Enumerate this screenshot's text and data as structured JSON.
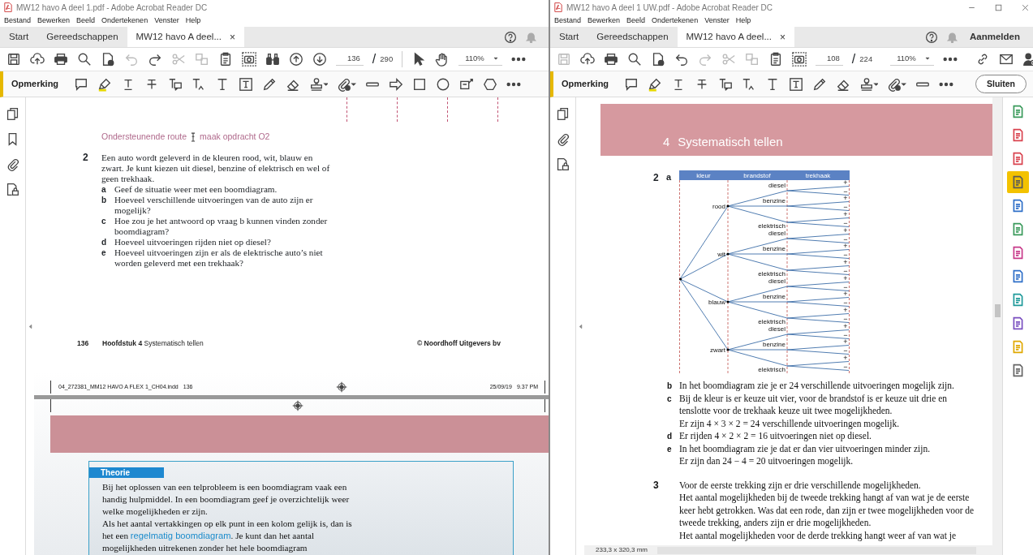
{
  "windows": [
    {
      "title": "MW12 havo A deel 1.pdf - Adobe Acrobat Reader DC",
      "menu": [
        "Bestand",
        "Bewerken",
        "Beeld",
        "Ondertekenen",
        "Venster",
        "Help"
      ],
      "tabs": [
        {
          "label": "Start",
          "selected": false
        },
        {
          "label": "Gereedschappen",
          "selected": false
        },
        {
          "label": "MW12 havo A deel...",
          "selected": true,
          "close": "×"
        }
      ],
      "toolbar": [
        {
          "kind": "save",
          "disabled": false
        },
        {
          "kind": "upload",
          "disabled": false
        },
        {
          "kind": "print",
          "disabled": false
        },
        {
          "kind": "search",
          "disabled": false
        },
        {
          "kind": "filecheck",
          "disabled": false
        },
        {
          "kind": "undo",
          "disabled": true
        },
        {
          "kind": "redo",
          "disabled": false
        },
        {
          "kind": "cut",
          "disabled": true
        },
        {
          "kind": "copy",
          "disabled": true
        },
        {
          "kind": "clipboard",
          "disabled": false
        },
        {
          "kind": "snapshot",
          "disabled": false
        },
        {
          "kind": "binoculars",
          "disabled": false
        },
        {
          "kind": "pageup",
          "disabled": false
        },
        {
          "kind": "pagedown",
          "disabled": false
        },
        {
          "kind": "page",
          "current": "136",
          "separator": "/",
          "total": "290"
        },
        {
          "kind": "divider"
        },
        {
          "kind": "pointer",
          "disabled": false
        },
        {
          "kind": "hand",
          "disabled": false
        },
        {
          "kind": "zoom",
          "value": "110%"
        },
        {
          "kind": "more",
          "disabled": false
        }
      ],
      "comment_label": "Opmerking",
      "comment_tools": [
        {
          "kind": "comment"
        },
        {
          "kind": "highlight"
        },
        {
          "kind": "underline"
        },
        {
          "kind": "strike"
        },
        {
          "kind": "replace"
        },
        {
          "kind": "insert"
        },
        {
          "kind": "text"
        },
        {
          "kind": "textbox"
        },
        {
          "kind": "pencil"
        },
        {
          "kind": "eraser"
        },
        {
          "kind": "stamp"
        },
        {
          "kind": "attach"
        },
        {
          "kind": "line"
        },
        {
          "kind": "arrow"
        },
        {
          "kind": "rect"
        },
        {
          "kind": "oval"
        },
        {
          "kind": "callout"
        },
        {
          "kind": "polygon"
        },
        {
          "kind": "more"
        }
      ],
      "side_panel": [
        {
          "kind": "pages"
        },
        {
          "kind": "bookmark"
        },
        {
          "kind": "clip"
        },
        {
          "kind": "lockdoc"
        }
      ],
      "document": [
        {
          "kind": "crop-marks"
        },
        {
          "kind": "route",
          "parts": [
            "Ondersteunende route",
            "maak opdracht O2"
          ]
        },
        {
          "kind": "exercise",
          "number": "2",
          "paragraphs": [
            "Een auto wordt geleverd in de kleuren rood, wit, blauw en zwart. Je kunt kiezen uit diesel, benzine of elektrisch en wel of geen trekhaak."
          ],
          "items": [
            {
              "letter": "a",
              "paragraphs": [
                "Geef de situatie weer met een boomdiagram."
              ]
            },
            {
              "letter": "b",
              "paragraphs": [
                "Hoeveel verschillende uitvoeringen van de auto zijn er mogelijk?"
              ]
            },
            {
              "letter": "c",
              "paragraphs": [
                "Hoe zou je het antwoord op vraag b kunnen vinden zonder boomdiagram?"
              ]
            },
            {
              "letter": "d",
              "paragraphs": [
                "Hoeveel uitvoeringen rijden niet op diesel?"
              ]
            },
            {
              "letter": "e",
              "paragraphs": [
                "Hoeveel uitvoeringen zijn er als de elektrische auto’s niet worden geleverd met een trekhaak?"
              ]
            }
          ]
        },
        {
          "kind": "footer",
          "page": "136",
          "chapter": "**Hoofdstuk 4** Systematisch tellen",
          "copyright": "© Noordhoff Uitgevers bv"
        },
        {
          "kind": "slug",
          "file": "04_272381_MM12 HAVO A FLEX 1_CH04.indd",
          "page": "136",
          "date": "25/09/19",
          "time": "9.37 PM"
        },
        {
          "kind": "page-break"
        },
        {
          "kind": "band"
        },
        {
          "kind": "theory",
          "title": "Theorie",
          "paragraphs": [
            "Bij het oplossen van een telprobleem is een boomdiagram vaak een handig hulpmiddel. In een boomdiagram geef je overzichtelijk weer welke mogelijkheden er zijn.",
            "Als het aantal vertakkingen op elk punt in een kolom gelijk is, dan is het een **regelmatig boomdiagram**. Je kunt dan het aantal mogelijkheden uitrekenen zonder het hele boomdiagram"
          ]
        }
      ]
    },
    {
      "title": "MW12 havo A deel 1 UW.pdf - Adobe Acrobat Reader DC",
      "window_controls": true,
      "menu": [
        "Bestand",
        "Bewerken",
        "Beeld",
        "Ondertekenen",
        "Venster",
        "Help"
      ],
      "tabs": [
        {
          "label": "Start",
          "selected": false
        },
        {
          "label": "Gereedschappen",
          "selected": false
        },
        {
          "label": "MW12 havo A deel...",
          "selected": true,
          "close": "×"
        }
      ],
      "sign_in": "Aanmelden",
      "toolbar": [
        {
          "kind": "save",
          "disabled": true
        },
        {
          "kind": "upload",
          "disabled": false
        },
        {
          "kind": "print",
          "disabled": false
        },
        {
          "kind": "search",
          "disabled": false
        },
        {
          "kind": "filecheck",
          "disabled": false
        },
        {
          "kind": "undo",
          "disabled": false
        },
        {
          "kind": "redo",
          "disabled": true
        },
        {
          "kind": "cut",
          "disabled": true
        },
        {
          "kind": "copy",
          "disabled": true
        },
        {
          "kind": "clipboard",
          "disabled": false
        },
        {
          "kind": "snapshot",
          "disabled": false
        },
        {
          "kind": "page",
          "current": "108",
          "separator": "/",
          "total": "224"
        },
        {
          "kind": "divider"
        },
        {
          "kind": "zoom",
          "value": "110%"
        },
        {
          "kind": "more",
          "disabled": false
        },
        {
          "kind": "spacer"
        },
        {
          "kind": "link",
          "disabled": false
        },
        {
          "kind": "mail",
          "disabled": false
        },
        {
          "kind": "person",
          "disabled": false
        }
      ],
      "comment_label": "Opmerking",
      "comment_tools": [
        {
          "kind": "comment"
        },
        {
          "kind": "highlight"
        },
        {
          "kind": "underline"
        },
        {
          "kind": "strike"
        },
        {
          "kind": "replace"
        },
        {
          "kind": "insert"
        },
        {
          "kind": "text"
        },
        {
          "kind": "textbox"
        },
        {
          "kind": "pencil"
        },
        {
          "kind": "eraser"
        },
        {
          "kind": "stamp"
        },
        {
          "kind": "attach"
        },
        {
          "kind": "line"
        },
        {
          "kind": "more"
        }
      ],
      "close_button": "Sluiten",
      "side_panel": [
        {
          "kind": "pages"
        },
        {
          "kind": "clip"
        },
        {
          "kind": "lockdoc"
        }
      ],
      "rail": [
        {
          "color": "#3a9a5b",
          "selected": false
        },
        {
          "color": "#d9434f",
          "selected": false
        },
        {
          "color": "#d9434f",
          "selected": false
        },
        {
          "color": "#5a5a5a",
          "selected": true
        },
        {
          "color": "#2f6fc8",
          "selected": false
        },
        {
          "color": "#3a9a5b",
          "selected": false
        },
        {
          "color": "#c83a8a",
          "selected": false
        },
        {
          "color": "#2f6fc8",
          "selected": false
        },
        {
          "color": "#1f9a9a",
          "selected": false
        },
        {
          "color": "#7a4fc0",
          "selected": false
        },
        {
          "color": "#e0a800",
          "selected": false
        },
        {
          "color": "#666666",
          "selected": false
        }
      ],
      "status": "233,3 x 320,3 mm",
      "document": [
        {
          "kind": "chapter-header",
          "number": "4",
          "title": "Systematisch tellen"
        },
        {
          "kind": "tree",
          "number": "2",
          "letter": "a",
          "columns": [
            "kleur",
            "brandstof",
            "trekhaak"
          ],
          "branches": [
            {
              "label": "rood",
              "children": [
                {
                  "label": "diesel",
                  "children": [
                    "+",
                    "−"
                  ]
                },
                {
                  "label": "benzine",
                  "children": [
                    "+",
                    "−"
                  ]
                },
                {
                  "label": "elektrisch",
                  "children": [
                    "+",
                    "−"
                  ]
                }
              ]
            },
            {
              "label": "wit",
              "children": [
                {
                  "label": "diesel",
                  "children": [
                    "+",
                    "−"
                  ]
                },
                {
                  "label": "benzine",
                  "children": [
                    "+",
                    "−"
                  ]
                },
                {
                  "label": "elektrisch",
                  "children": [
                    "+",
                    "−"
                  ]
                }
              ]
            },
            {
              "label": "blauw",
              "children": [
                {
                  "label": "diesel",
                  "children": [
                    "+",
                    "−"
                  ]
                },
                {
                  "label": "benzine",
                  "children": [
                    "+",
                    "−"
                  ]
                },
                {
                  "label": "elektrisch",
                  "children": [
                    "+",
                    "−"
                  ]
                }
              ]
            },
            {
              "label": "zwart",
              "children": [
                {
                  "label": "diesel",
                  "children": [
                    "+",
                    "−"
                  ]
                },
                {
                  "label": "benzine",
                  "children": [
                    "+",
                    "−"
                  ]
                },
                {
                  "label": "elektrisch",
                  "children": [
                    "+",
                    "−"
                  ]
                }
              ]
            }
          ]
        },
        {
          "kind": "answers",
          "items": [
            {
              "letter": "b",
              "paragraphs": [
                "In het boomdiagram zie je er 24 verschillende uitvoeringen mogelijk zijn."
              ]
            },
            {
              "letter": "c",
              "paragraphs": [
                "Bij de kleur is er keuze uit vier, voor de brandstof is er keuze uit drie en tenslotte voor de trekhaak keuze uit twee mogelijkheden.",
                "Er zijn 4 × 3 × 2 = 24 verschillende uitvoeringen mogelijk."
              ]
            },
            {
              "letter": "d",
              "paragraphs": [
                "Er rijden 4 × 2 × 2 = 16 uitvoeringen niet op diesel."
              ]
            },
            {
              "letter": "e",
              "paragraphs": [
                "In het boomdiagram zie je dat er dan vier uitvoeringen minder zijn.",
                "Er zijn dan 24 − 4 = 20 uitvoeringen mogelijk."
              ]
            }
          ]
        },
        {
          "kind": "exercise",
          "number": "3",
          "paragraphs": [
            "Voor de eerste trekking zijn er drie verschillende mogelijkheden.",
            "Het aantal mogelijkheden bij de tweede trekking hangt af van wat je de eerste keer hebt getrokken. Was dat een rode, dan zijn er twee mogelijkheden voor de tweede trekking, anders zijn er drie mogelijkheden.",
            "Het aantal mogelijkheden voor de derde trekking hangt weer af van wat je"
          ]
        }
      ]
    }
  ]
}
